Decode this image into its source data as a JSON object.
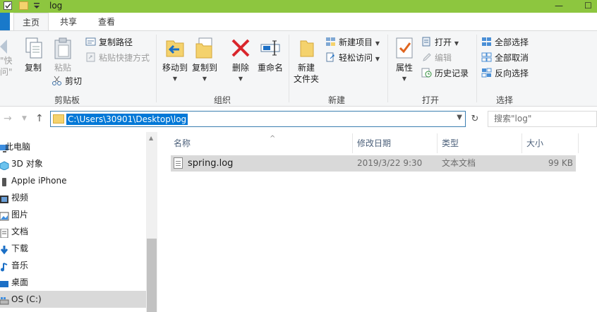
{
  "window": {
    "title": "log"
  },
  "tabs": [
    {
      "label": "主页"
    },
    {
      "label": "共享"
    },
    {
      "label": "查看"
    }
  ],
  "ribbon": {
    "clipboard": {
      "pin_label_1": "\"快",
      "pin_label_2": "问\"",
      "copy": "复制",
      "paste": "粘贴",
      "copy_path": "复制路径",
      "paste_shortcut": "粘贴快捷方式",
      "cut": "剪切",
      "group": "剪贴板"
    },
    "organize": {
      "move_to": "移动到",
      "copy_to": "复制到",
      "delete": "删除",
      "rename": "重命名",
      "group": "组织"
    },
    "new": {
      "new_folder_1": "新建",
      "new_folder_2": "文件夹",
      "new_item": "新建项目",
      "easy_access": "轻松访问",
      "group": "新建"
    },
    "open": {
      "properties": "属性",
      "open": "打开",
      "edit": "编辑",
      "history": "历史记录",
      "group": "打开"
    },
    "select": {
      "select_all": "全部选择",
      "select_none": "全部取消",
      "invert": "反向选择",
      "group": "选择"
    }
  },
  "address": {
    "path": "C:\\Users\\30901\\Desktop\\log",
    "search_placeholder": "搜索\"log\""
  },
  "nav_pane": {
    "items": [
      {
        "label": "此电脑",
        "icon": "pc-icon"
      },
      {
        "label": "3D 对象",
        "icon": "3d-objects-icon"
      },
      {
        "label": "Apple iPhone",
        "icon": "phone-icon"
      },
      {
        "label": "视频",
        "icon": "video-icon"
      },
      {
        "label": "图片",
        "icon": "pictures-icon"
      },
      {
        "label": "文档",
        "icon": "documents-icon"
      },
      {
        "label": "下载",
        "icon": "download-icon"
      },
      {
        "label": "音乐",
        "icon": "music-icon"
      },
      {
        "label": "桌面",
        "icon": "desktop-icon"
      },
      {
        "label": "OS (C:)",
        "icon": "drive-icon"
      }
    ]
  },
  "file_list": {
    "columns": [
      "名称",
      "修改日期",
      "类型",
      "大小"
    ],
    "rows": [
      {
        "name": "spring.log",
        "modified": "2019/3/22 9:30",
        "type": "文本文档",
        "size": "99 KB"
      }
    ]
  },
  "colors": {
    "titlebar": "#8dc63f",
    "accent": "#0078d7",
    "selection": "#d9d9d9"
  }
}
